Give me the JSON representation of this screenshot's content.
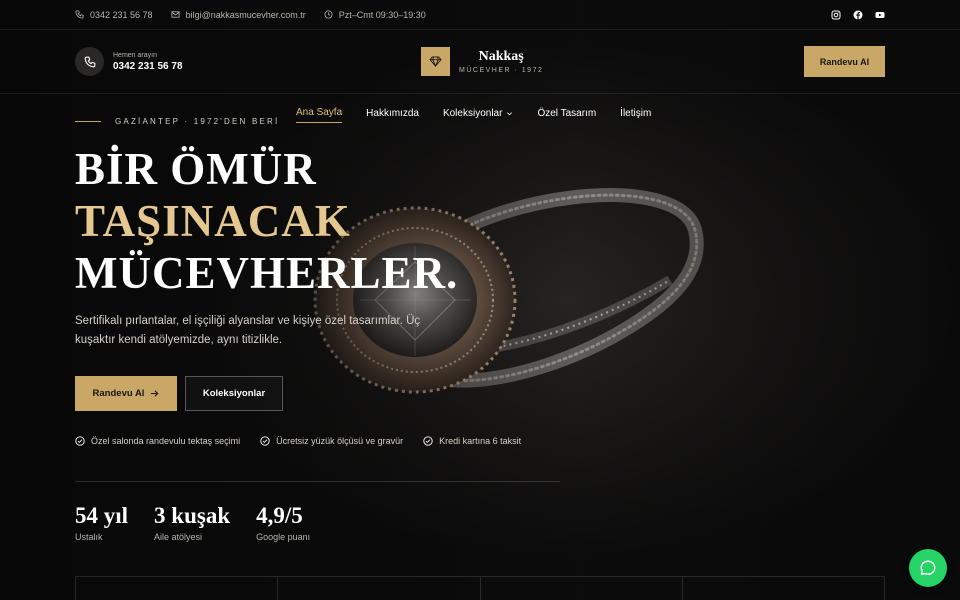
{
  "topbar": {
    "phone": "0342 231 56 78",
    "email": "bilgi@nakkasmucevher.com.tr",
    "hours": "Pzt–Cmt 09:30–19:30",
    "social": [
      "instagram-icon",
      "facebook-icon",
      "youtube-icon"
    ]
  },
  "header": {
    "call_label": "Hemen arayın",
    "call_number": "0342 231 56 78",
    "brand_name": "Nakkaş",
    "brand_sub": "MÜCEVHER · 1972",
    "appointment_button": "Randevu Al"
  },
  "nav": {
    "items": [
      {
        "label": "Ana Sayfa"
      },
      {
        "label": "Hakkımızda"
      },
      {
        "label": "Koleksiyonlar"
      },
      {
        "label": "Özel Tasarım"
      },
      {
        "label": "İletişim"
      }
    ]
  },
  "hero": {
    "eyebrow": "GAZİANTEP · 1972'DEN BERİ",
    "headline_1": "BİR ÖMÜR",
    "headline_2": "TAŞINACAK",
    "headline_3": "MÜCEVHERLER.",
    "lede": "Sertifikalı pırlantalar, el işçiliği alyanslar ve kişiye özel tasarımlar. Üç kuşaktır kendi atölyemizde, aynı titizlikle.",
    "cta_primary": "Randevu Al",
    "cta_secondary": "Koleksiyonlar",
    "features": [
      "Özel salonda randevulu tektaş seçimi",
      "Ücretsiz yüzük ölçüsü ve gravür",
      "Kredi kartına 6 taksit"
    ],
    "stats": [
      {
        "value": "54 yıl",
        "label": "Ustalık"
      },
      {
        "value": "3 kuşak",
        "label": "Aile atölyesi"
      },
      {
        "value": "4,9/5",
        "label": "Google puanı"
      }
    ]
  },
  "colors": {
    "gold": "#c9a767",
    "gold_text": "#e4c88f",
    "background": "#0b0b0b",
    "whatsapp": "#25d366"
  }
}
